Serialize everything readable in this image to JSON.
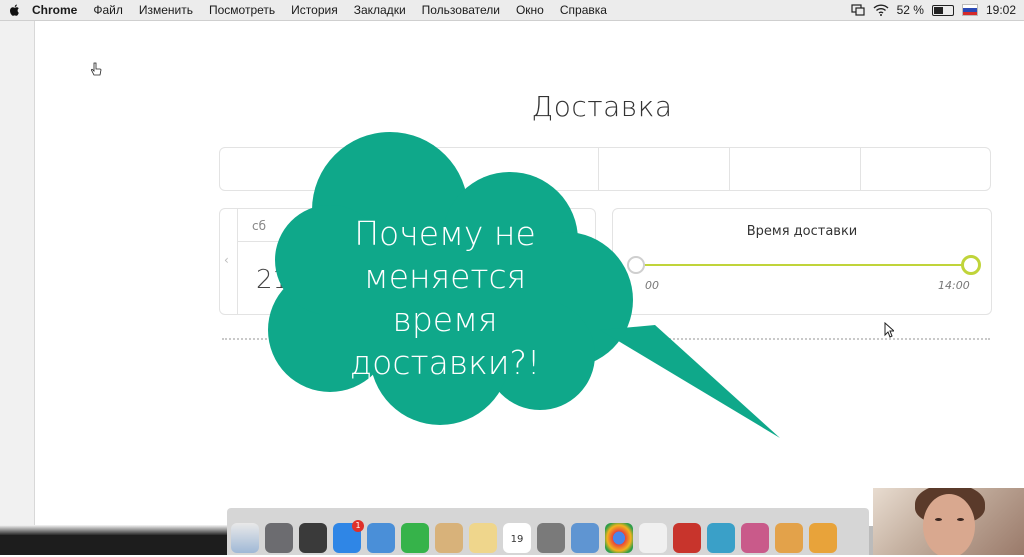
{
  "menubar": {
    "app_name": "Chrome",
    "items": [
      "Файл",
      "Изменить",
      "Посмотреть",
      "История",
      "Закладки",
      "Пользователи",
      "Окно",
      "Справка"
    ],
    "battery_percent": "52 %",
    "battery_level": 0.52,
    "clock": "19:02"
  },
  "page": {
    "title": "Доставка",
    "date": {
      "day_name": "сб",
      "day_number": "21"
    },
    "delivery_time": {
      "title": "Время доставки",
      "min_label": "00",
      "max_label": "14:00"
    }
  },
  "overlay": {
    "callout_text": "Почему не меняется время доставки?!",
    "callout_color": "#0fa88a"
  },
  "dock": {
    "badge_count": "1",
    "calendar_day": "19"
  },
  "colors": {
    "accent": "#c0d43a",
    "callout": "#0fa88a"
  }
}
